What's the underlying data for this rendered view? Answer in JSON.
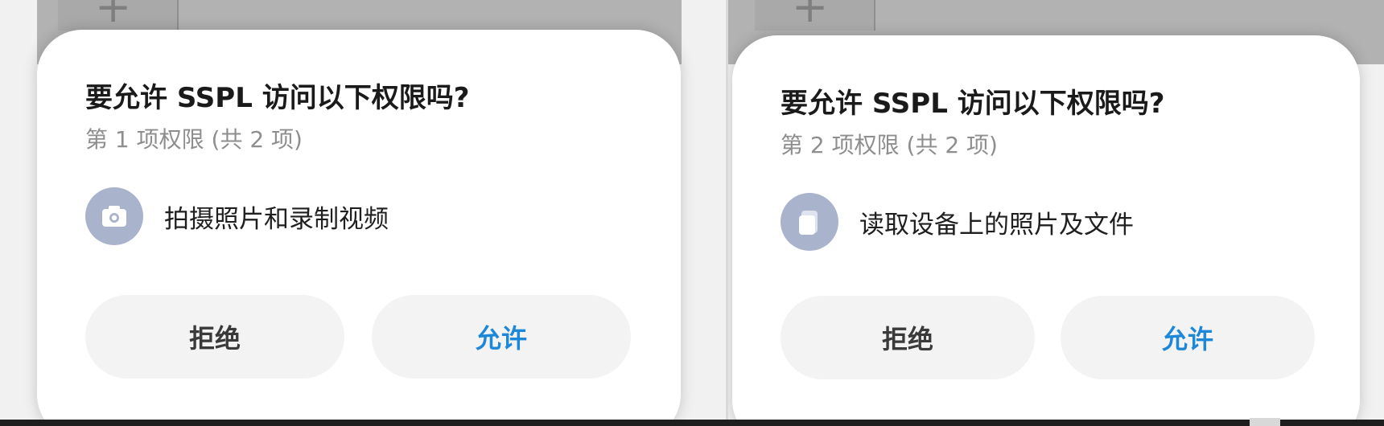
{
  "screens": [
    {
      "title": "要允许 SSPL 访问以下权限吗?",
      "progress": "第 1 项权限 (共 2 项)",
      "permission": {
        "icon": "camera-icon",
        "label": "拍摄照片和录制视频"
      },
      "buttons": {
        "deny": "拒绝",
        "allow": "允许"
      }
    },
    {
      "title": "要允许 SSPL 访问以下权限吗?",
      "progress": "第 2 项权限 (共 2 项)",
      "permission": {
        "icon": "files-icon",
        "label": "读取设备上的照片及文件"
      },
      "buttons": {
        "deny": "拒绝",
        "allow": "允许"
      }
    }
  ],
  "colors": {
    "allow_text": "#1e88d8",
    "deny_text": "#3a3a3a",
    "icon_bg": "#a9b3cc",
    "dialog_bg": "#ffffff"
  },
  "backdrop": {
    "plus_glyph": "+"
  }
}
